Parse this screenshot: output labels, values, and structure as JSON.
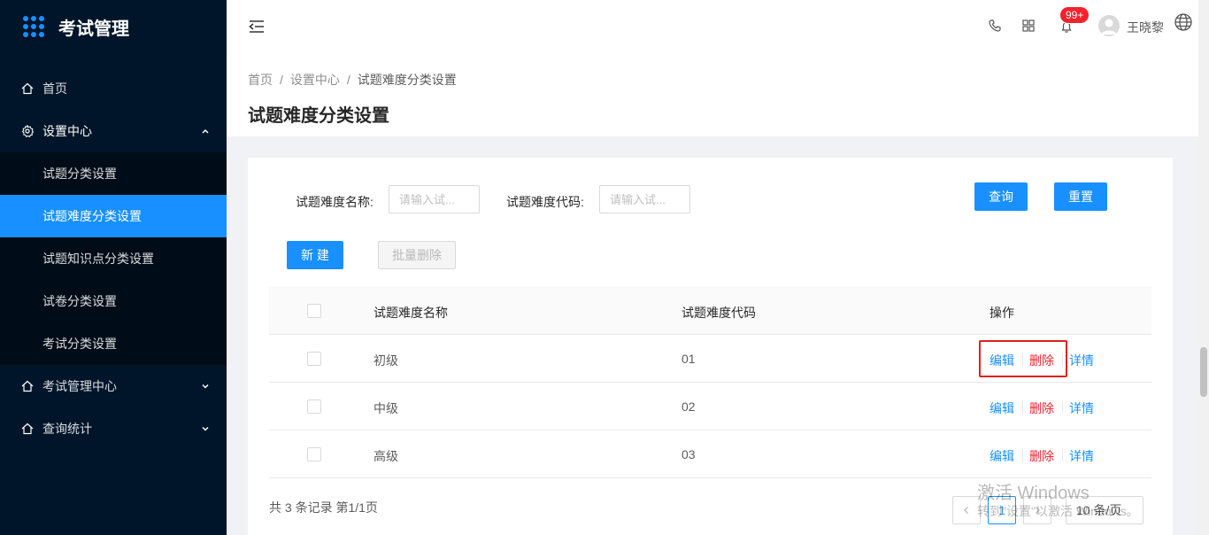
{
  "app": {
    "title": "考试管理"
  },
  "sidebar": {
    "items": [
      {
        "label": "首页",
        "icon": "home-icon"
      },
      {
        "label": "设置中心",
        "icon": "gear-icon",
        "expanded": true,
        "children": [
          "试题分类设置",
          "试题难度分类设置",
          "试题知识点分类设置",
          "试卷分类设置",
          "考试分类设置"
        ],
        "active_child": "试题难度分类设置"
      },
      {
        "label": "考试管理中心",
        "icon": "home-icon"
      },
      {
        "label": "查询统计",
        "icon": "home-icon"
      }
    ]
  },
  "header": {
    "notification_count": "99+",
    "user_name": "王晓黎"
  },
  "breadcrumb": [
    "首页",
    "设置中心",
    "试题难度分类设置"
  ],
  "page_title": "试题难度分类设置",
  "search": {
    "name_label": "试题难度名称:",
    "name_placeholder": "请输入试...",
    "code_label": "试题难度代码:",
    "code_placeholder": "请输入试...",
    "query_button": "查询",
    "reset_button": "重置"
  },
  "actions": {
    "new_button": "新 建",
    "batch_delete_button": "批量删除"
  },
  "table": {
    "columns": [
      "试题难度名称",
      "试题难度代码",
      "操作"
    ],
    "rows": [
      {
        "name": "初级",
        "code": "01"
      },
      {
        "name": "中级",
        "code": "02"
      },
      {
        "name": "高级",
        "code": "03"
      }
    ],
    "row_actions": {
      "edit": "编辑",
      "delete": "删除",
      "detail": "详情"
    }
  },
  "pagination": {
    "summary": "共 3 条记录 第1/1页",
    "current_page": "1",
    "page_size": "10 条/页"
  },
  "watermark": {
    "title": "激活 Windows",
    "subtitle": "转到\"设置\"以激活 Windows。"
  },
  "colors": {
    "sidebar_bg": "#001529",
    "primary": "#1890ff",
    "danger": "#f5222d"
  }
}
